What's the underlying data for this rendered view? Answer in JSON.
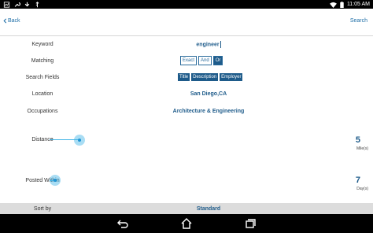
{
  "status_bar": {
    "time": "11:05 AM"
  },
  "header": {
    "back_label": "Back",
    "search_label": "Search"
  },
  "form": {
    "keyword": {
      "label": "Keyword",
      "value": "engineer"
    },
    "matching": {
      "label": "Matching",
      "options": [
        "Exact",
        "And",
        "Or"
      ],
      "selected": "Or"
    },
    "search_fields": {
      "label": "Search Fields",
      "options": [
        "Title",
        "Description",
        "Employer"
      ]
    },
    "location": {
      "label": "Location",
      "value": "San Diego,CA"
    },
    "occupations": {
      "label": "Occupations",
      "value": "Architecture & Engineering"
    },
    "distance": {
      "label": "Distance",
      "value": "5",
      "unit": "Mile(s)"
    },
    "posted_within": {
      "label": "Posted Within",
      "value": "7",
      "unit": "Day(s)"
    },
    "sort_by": {
      "label": "Sort by",
      "value": "Standard"
    }
  },
  "colors": {
    "accent": "#1e5b8a",
    "link": "#1e6ea7",
    "slider": "#40b4e6"
  }
}
